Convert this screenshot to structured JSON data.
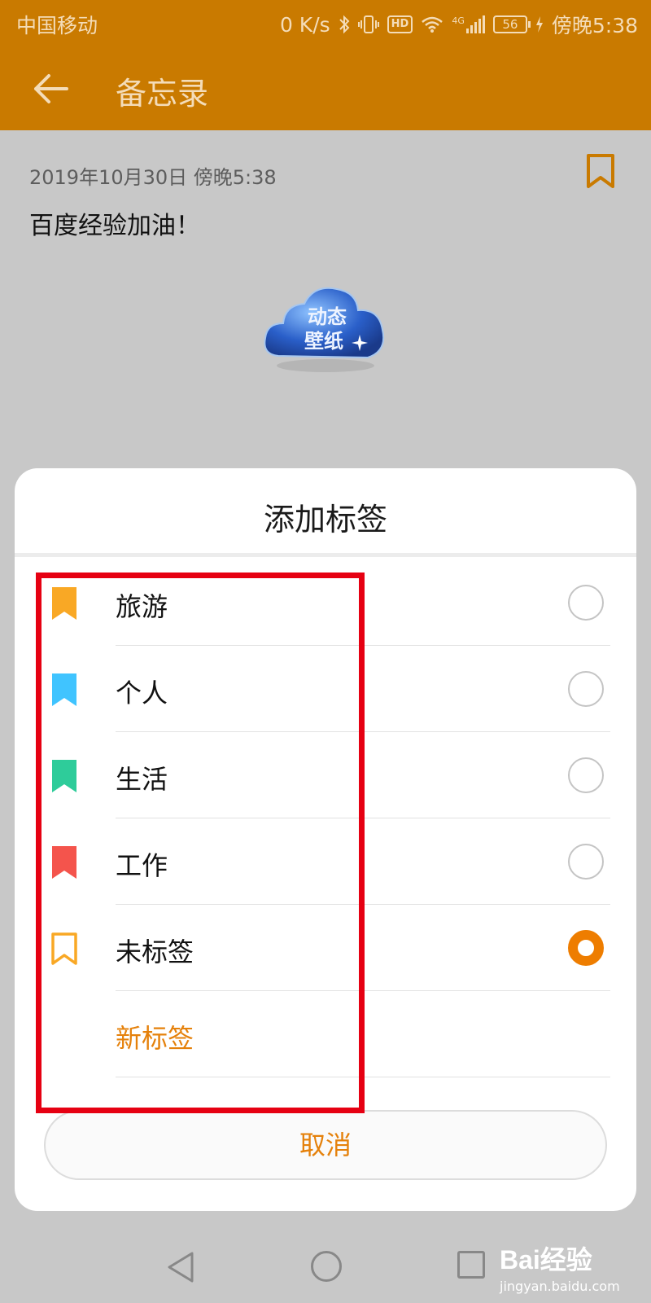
{
  "status_bar": {
    "carrier": "中国移动",
    "speed": "0 K/s",
    "hd": "HD",
    "network": "4G",
    "battery": "56",
    "time": "傍晚5:38"
  },
  "app_bar": {
    "title": "备忘录",
    "color": "#c97a00"
  },
  "note": {
    "date": "2019年10月30日 傍晚5:38",
    "body": "百度经验加油！",
    "sticker_text_line1": "动态",
    "sticker_text_line2": "壁纸"
  },
  "dialog": {
    "title": "添加标签",
    "tags": [
      {
        "label": "旅游",
        "color": "#f9a825",
        "selected": false
      },
      {
        "label": "个人",
        "color": "#40c4ff",
        "selected": false
      },
      {
        "label": "生活",
        "color": "#2ecc9a",
        "selected": false
      },
      {
        "label": "工作",
        "color": "#f4544c",
        "selected": false
      },
      {
        "label": "未标签",
        "color": "#f9a825",
        "selected": true
      }
    ],
    "new_tag_label": "新标签",
    "cancel_label": "取消"
  },
  "accent_color": "#ee7d00",
  "watermark": {
    "main": "Bai经验",
    "sub": "jingyan.baidu.com"
  }
}
